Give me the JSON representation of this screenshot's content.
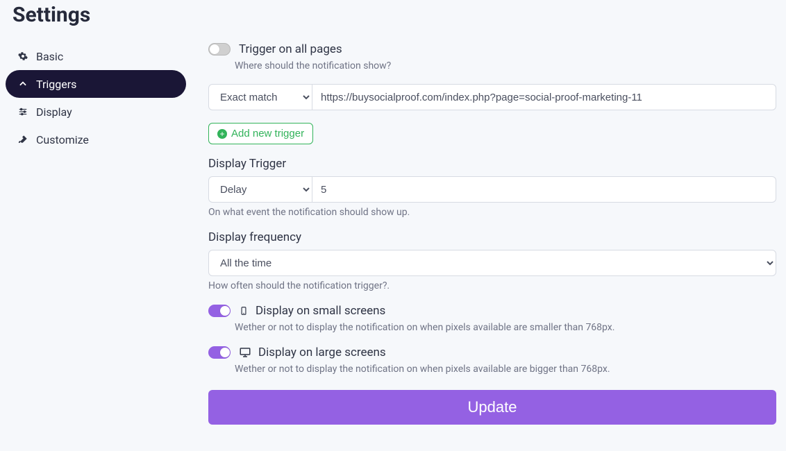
{
  "page": {
    "title": "Settings"
  },
  "sidebar": {
    "items": [
      {
        "label": "Basic"
      },
      {
        "label": "Triggers"
      },
      {
        "label": "Display"
      },
      {
        "label": "Customize"
      }
    ]
  },
  "triggers": {
    "all_pages": {
      "label": "Trigger on all pages",
      "help": "Where should the notification show?",
      "enabled": false
    },
    "match_row": {
      "type": "Exact match",
      "url": "https://buysocialproof.com/index.php?page=social-proof-marketing-11"
    },
    "add_new_label": "Add new trigger",
    "display_trigger": {
      "label": "Display Trigger",
      "type": "Delay",
      "value": "5",
      "help": "On what event the notification should show up."
    },
    "frequency": {
      "label": "Display frequency",
      "value": "All the time",
      "help": "How often should the notification trigger?."
    },
    "small_screens": {
      "label": "Display on small screens",
      "help": "Wether or not to display the notification on when pixels available are smaller than 768px.",
      "enabled": true
    },
    "large_screens": {
      "label": "Display on large screens",
      "help": "Wether or not to display the notification on when pixels available are bigger than 768px.",
      "enabled": true
    },
    "update_label": "Update"
  }
}
